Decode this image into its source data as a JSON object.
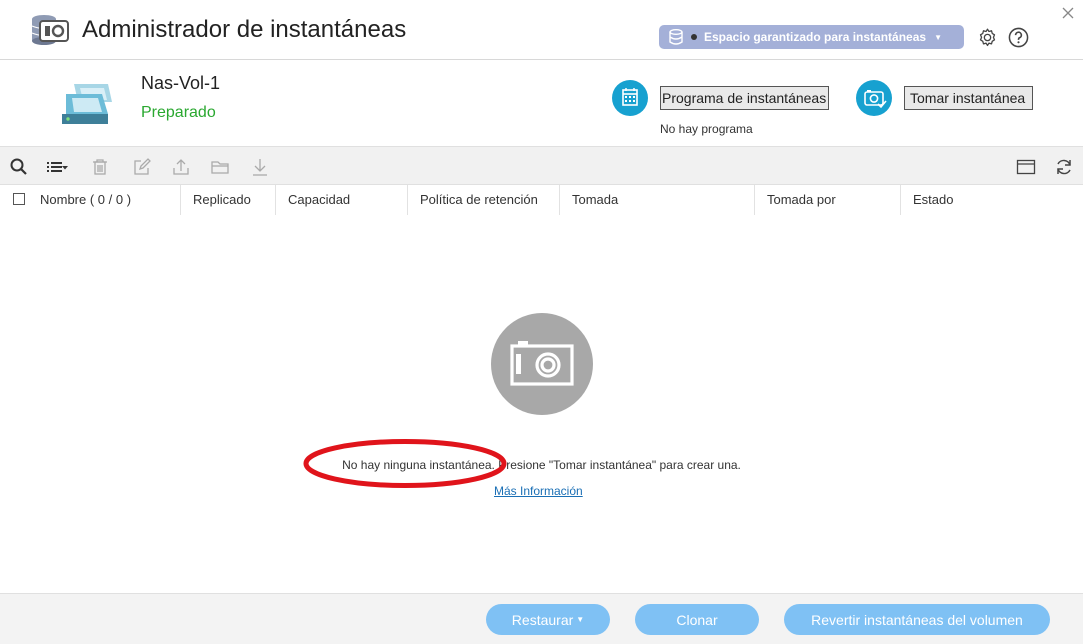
{
  "window": {
    "title": "Administrador de instantáneas",
    "space_button_label": "Espacio garantizado para instantáneas",
    "icons": [
      "snapshot-manager-icon",
      "database-icon",
      "gear-icon",
      "help-icon",
      "close-icon"
    ]
  },
  "volume": {
    "name": "Nas-Vol-1",
    "status": "Preparado",
    "schedule_button": "Programa de instantáneas",
    "schedule_status": "No hay programa",
    "take_button": "Tomar instantánea"
  },
  "toolbar": {
    "icons": [
      "search-icon",
      "list-view-icon",
      "delete-icon",
      "edit-icon",
      "export-icon",
      "folder-icon",
      "download-icon",
      "columns-icon",
      "refresh-icon"
    ]
  },
  "table": {
    "columns": [
      "Nombre ( 0 / 0 )",
      "Replicado",
      "Capacidad",
      "Política de retención",
      "Tomada",
      "Tomada por",
      "Estado"
    ],
    "rows": []
  },
  "empty": {
    "message": "No hay ninguna instantánea. Presione \"Tomar instantánea\" para crear una.",
    "link": "Más Información"
  },
  "footer": {
    "restore": "Restaurar",
    "clone": "Clonar",
    "revert": "Revertir instantáneas del volumen"
  },
  "colors": {
    "accent": "#17a1d0",
    "status_ok": "#2aa830",
    "footer_button": "#7fc1f4",
    "space_button": "#a4b0d8",
    "annotation": "#e0141b"
  }
}
